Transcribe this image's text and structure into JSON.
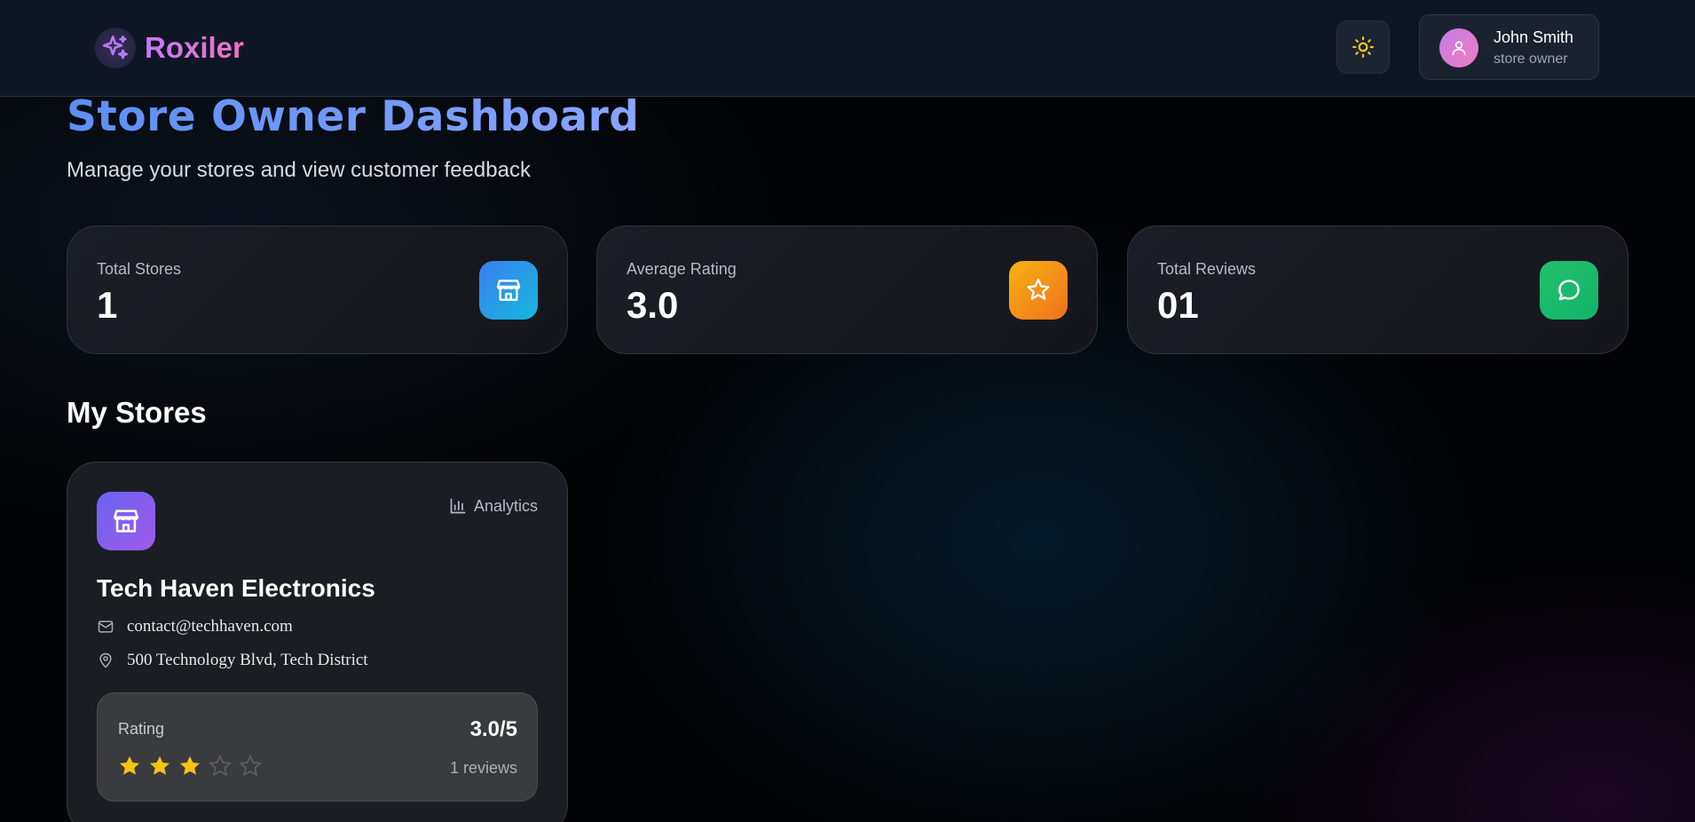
{
  "header": {
    "brand": "Roxiler",
    "logo_icon": "sparkles-icon",
    "theme_icon": "sun-icon",
    "user": {
      "name": "John Smith",
      "role": "store owner",
      "avatar_icon": "user-icon"
    }
  },
  "page": {
    "title": "Store Owner Dashboard",
    "subtitle": "Manage your stores and view customer feedback"
  },
  "stats": [
    {
      "label": "Total Stores",
      "value": "1",
      "icon": "store-icon",
      "color": "#2f8ff0"
    },
    {
      "label": "Average Rating",
      "value": "3.0",
      "icon": "star-icon",
      "color": "#f59a16"
    },
    {
      "label": "Total Reviews",
      "value": "01",
      "icon": "message-icon",
      "color": "#1cbc6d"
    }
  ],
  "section": {
    "title": "My Stores"
  },
  "stores": [
    {
      "name": "Tech Haven Electronics",
      "email": "contact@techhaven.com",
      "address": "500 Technology Blvd, Tech District",
      "analytics_label": "Analytics",
      "rating_label": "Rating",
      "rating_value": "3.0/5",
      "rating": 3,
      "rating_max": 5,
      "reviews": "1 reviews"
    }
  ],
  "colors": {
    "star_filled": "#f6c213",
    "star_empty": "#5b5e66",
    "accent": "#6c8ff5"
  }
}
